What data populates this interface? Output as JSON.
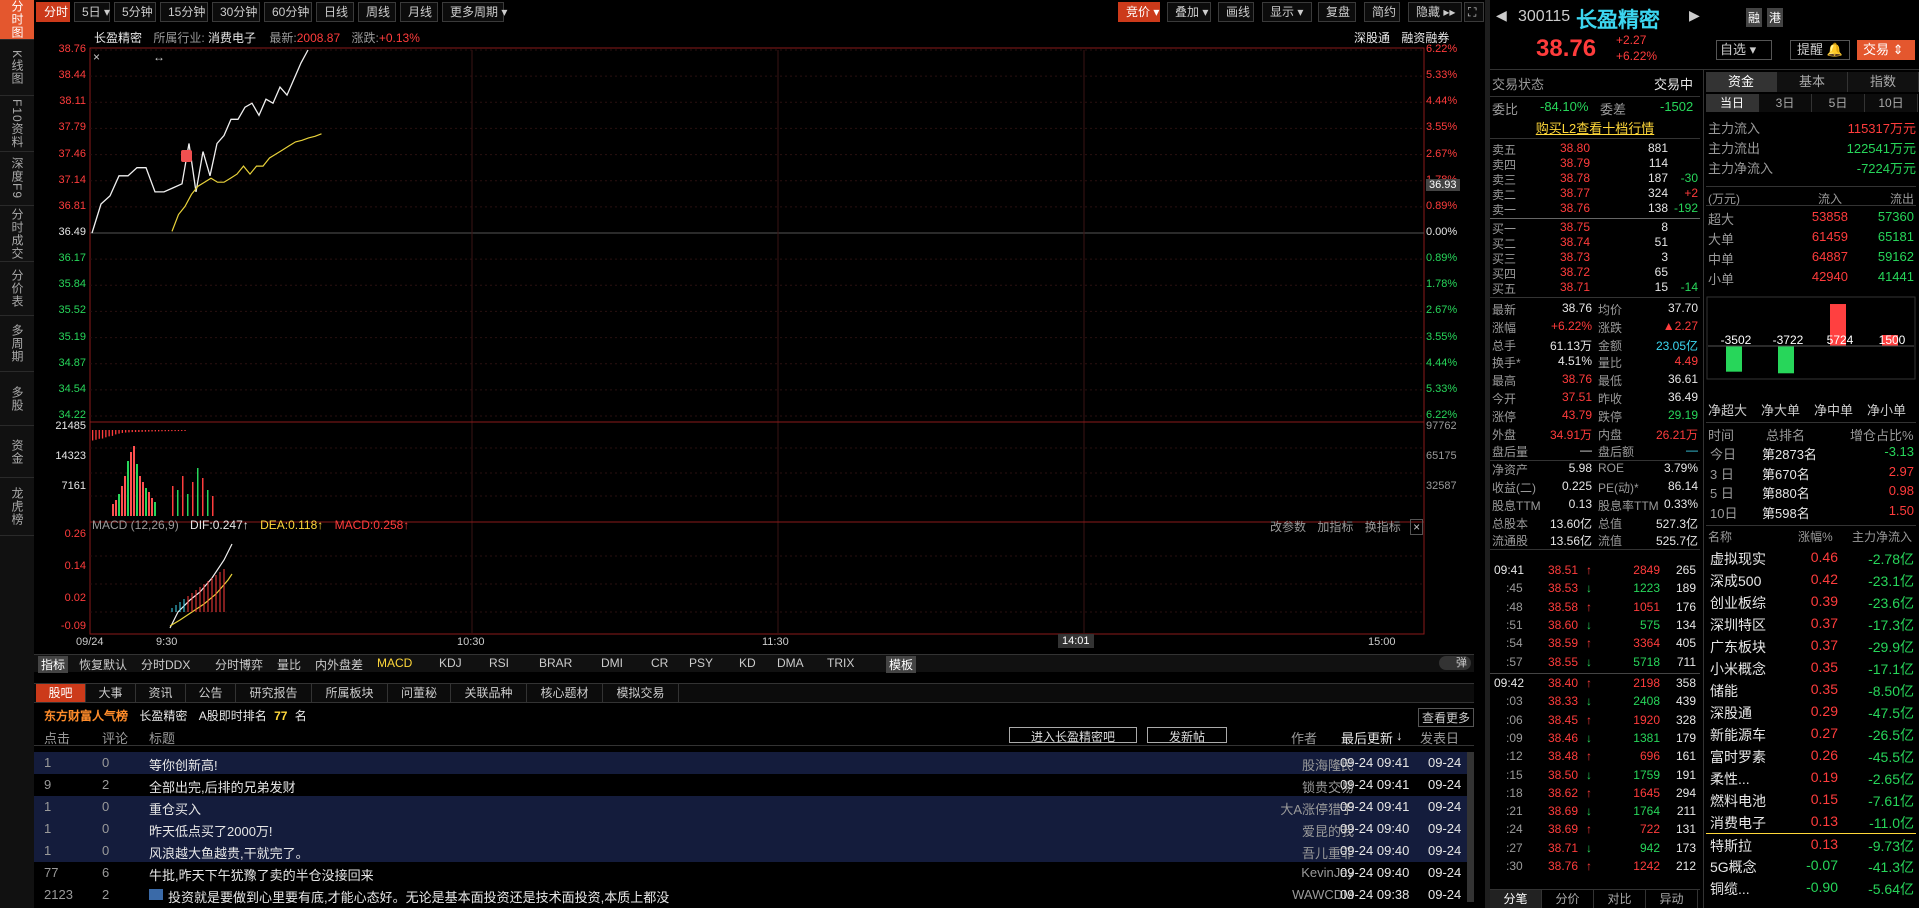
{
  "side_tabs": [
    "分时图",
    "K线图",
    "F10资料",
    "深度F9",
    "分时成交",
    "分价表",
    "多周期",
    "多股",
    "资金",
    "龙虎榜"
  ],
  "toolbar": {
    "periods": [
      "分时",
      "5日",
      "5分钟",
      "15分钟",
      "30分钟",
      "60分钟",
      "日线",
      "周线",
      "月线",
      "更多周期"
    ],
    "right": [
      "竞价",
      "叠加",
      "画线",
      "显示",
      "复盘",
      "简约",
      "隐藏"
    ]
  },
  "chart_header": {
    "name": "长盈精密",
    "industry_label": "所属行业:",
    "industry": "消费电子",
    "latest_label": "最新:",
    "latest": "2008.87",
    "change_label": "涨跌:",
    "change": "+0.13%",
    "links": [
      "深股通",
      "融资融券"
    ]
  },
  "chart_data": [
    {
      "type": "line",
      "x_ticks": [
        "09/24",
        "9:30",
        "10:30",
        "11:30",
        "14:01",
        "15:00"
      ],
      "y_ticks": [
        "38.76",
        "38.44",
        "38.11",
        "37.79",
        "37.46",
        "37.14",
        "36.81",
        "36.49",
        "36.17",
        "35.84",
        "35.52",
        "35.19",
        "34.87",
        "34.54",
        "34.22"
      ],
      "y_ticks_pct": [
        "6.22%",
        "5.33%",
        "4.44%",
        "3.55%",
        "2.67%",
        "1.78%",
        "0.89%",
        "0.00%",
        "0.89%",
        "1.78%",
        "2.67%",
        "3.55%",
        "4.44%",
        "5.33%",
        "6.22%"
      ],
      "ylim": [
        34.22,
        38.76
      ],
      "base": 36.49,
      "crosshair_price": "36.93",
      "crosshair_time": "14:01",
      "series": [
        {
          "values": [
            36.49,
            36.85,
            36.95,
            37.2,
            37.2,
            37.3,
            37.3,
            37.0,
            37.0,
            37.05,
            37.1,
            37.6,
            37.0,
            37.5,
            37.2,
            37.6,
            37.7,
            37.9,
            37.9,
            38.05,
            38.1,
            37.95,
            38.15,
            38.1,
            38.3,
            38.2,
            38.4,
            38.6,
            38.76
          ]
        },
        {
          "values": [
            36.49,
            36.7,
            36.8,
            36.95,
            37.05,
            37.1,
            37.15,
            37.1,
            37.1,
            37.15,
            37.2,
            37.3,
            37.2,
            37.3,
            37.3,
            37.4,
            37.45,
            37.5,
            37.55,
            37.6,
            37.62,
            37.65,
            37.67,
            37.7
          ]
        }
      ]
    },
    {
      "type": "bar",
      "y_ticks": [
        "21485",
        "14323",
        "7161"
      ],
      "y_ticks_right": [
        "97762",
        "65175",
        "32587"
      ],
      "values": [
        21485,
        20000,
        18000,
        17500,
        15000,
        13000,
        12000,
        9000,
        7500,
        6000,
        5200,
        4800,
        4300,
        4200,
        4000,
        3800,
        3500,
        3200,
        3000,
        2900,
        2800,
        2600,
        2500,
        2400,
        2300,
        2250,
        2200,
        2100,
        2000
      ]
    },
    {
      "type": "line",
      "title": "MACD (12,26,9)",
      "dif": "DIF:0.247",
      "dea": "DEA:0.118",
      "macd": "MACD:0.258",
      "links": [
        "改参数",
        "加指标",
        "换指标"
      ],
      "y_ticks": [
        "0.26",
        "0.14",
        "0.02",
        "-0.09"
      ]
    }
  ],
  "indicator_tabs": [
    "指标",
    "恢复默认",
    "分时DDX",
    "分时博弈",
    "量比",
    "内外盘差",
    "MACD",
    "KDJ",
    "RSI",
    "BRAR",
    "DMI",
    "CR",
    "PSY",
    "KD",
    "DMA",
    "TRIX",
    "模板"
  ],
  "bottom_tabs": [
    "股吧",
    "大事",
    "资讯",
    "公告",
    "研究报告",
    "所属板块",
    "问董秘",
    "关联品种",
    "核心题材",
    "模拟交易"
  ],
  "bottom_sub": {
    "rank_label": "东方财富人气榜",
    "stock": "长盈精密",
    "rank_text": "A股即时排名",
    "rank": "77",
    "unit": "名",
    "more": "查看更多"
  },
  "post_head": {
    "clicks": "点击",
    "comments": "评论",
    "title": "标题",
    "enter": "进入长盈精密吧",
    "post": "发新帖",
    "author": "作者",
    "latest": "最后更新",
    "date": "发表日"
  },
  "posts": [
    {
      "c": "1",
      "r": "0",
      "t": "等你创新高!",
      "a": "股海隆民",
      "u": "09-24 09:41",
      "d": "09-24"
    },
    {
      "c": "9",
      "r": "2",
      "t": "全部出完,后排的兄弟发财",
      "a": "锁贵交易",
      "u": "09-24 09:41",
      "d": "09-24"
    },
    {
      "c": "1",
      "r": "0",
      "t": "重仓买入",
      "a": "大A涨停猎手",
      "u": "09-24 09:41",
      "d": "09-24"
    },
    {
      "c": "1",
      "r": "0",
      "t": "昨天低点买了2000万!",
      "a": "爱昆的我",
      "u": "09-24 09:40",
      "d": "09-24"
    },
    {
      "c": "1",
      "r": "0",
      "t": "风浪越大鱼越贵,干就完了。",
      "a": "吾儿重菲",
      "u": "09-24 09:40",
      "d": "09-24"
    },
    {
      "c": "77",
      "r": "6",
      "t": "牛批,昨天下午犹豫了卖的半仓没接回来",
      "a": "KevinJay",
      "u": "09-24 09:40",
      "d": "09-24"
    },
    {
      "c": "2123",
      "r": "2",
      "t": "投资就是要做到心里要有底,才能心态好。无论是基本面投资还是技术面投资,本质上都没",
      "a": "WAWCDM",
      "u": "09-24 09:38",
      "d": "09-24"
    }
  ],
  "quote": {
    "code": "300115",
    "name": "长盈精密",
    "price": "38.76",
    "chg": "+2.27",
    "pct": "+6.22%",
    "btns": [
      "融",
      "港"
    ],
    "actions": [
      "自选",
      "提醒",
      "交易"
    ]
  },
  "status": {
    "label": "交易状态",
    "value": "交易中",
    "wb_label": "委比",
    "wb": "-84.10%",
    "wc_label": "委差",
    "wc": "-1502",
    "l2": "购买L2查看十档行情"
  },
  "sells": [
    {
      "l": "卖五",
      "p": "38.80",
      "v": "881",
      "d": ""
    },
    {
      "l": "卖四",
      "p": "38.79",
      "v": "114",
      "d": ""
    },
    {
      "l": "卖三",
      "p": "38.78",
      "v": "187",
      "d": "-30"
    },
    {
      "l": "卖二",
      "p": "38.77",
      "v": "324",
      "d": "+2"
    },
    {
      "l": "卖一",
      "p": "38.76",
      "v": "138",
      "d": "-192"
    }
  ],
  "buys": [
    {
      "l": "买一",
      "p": "38.75",
      "v": "8",
      "d": ""
    },
    {
      "l": "买二",
      "p": "38.74",
      "v": "51",
      "d": ""
    },
    {
      "l": "买三",
      "p": "38.73",
      "v": "3",
      "d": ""
    },
    {
      "l": "买四",
      "p": "38.72",
      "v": "65",
      "d": ""
    },
    {
      "l": "买五",
      "p": "38.71",
      "v": "15",
      "d": "-14"
    }
  ],
  "stats": [
    [
      "最新",
      "38.76",
      "均价",
      "37.70"
    ],
    [
      "涨幅",
      "+6.22%",
      "涨跌",
      "▲2.27"
    ],
    [
      "总手",
      "61.13万",
      "金额",
      "23.05亿"
    ],
    [
      "换手*",
      "4.51%",
      "量比",
      "4.49"
    ],
    [
      "最高",
      "38.76",
      "最低",
      "36.61"
    ],
    [
      "今开",
      "37.51",
      "昨收",
      "36.49"
    ],
    [
      "涨停",
      "43.79",
      "跌停",
      "29.19"
    ],
    [
      "外盘",
      "34.91万",
      "内盘",
      "26.21万"
    ],
    [
      "盘后量",
      "—",
      "盘后额",
      "—"
    ],
    [
      "净资产",
      "5.98",
      "ROE",
      "3.79%"
    ],
    [
      "收益(二)",
      "0.225",
      "PE(动)*",
      "86.14"
    ],
    [
      "股息TTM",
      "0.13",
      "股息率TTM",
      "0.33%"
    ],
    [
      "总股本",
      "13.60亿",
      "总值",
      "527.3亿"
    ],
    [
      "流通股",
      "13.56亿",
      "流值",
      "525.7亿"
    ]
  ],
  "ticks1": [
    {
      "t": "09:41",
      "p": "38.51",
      "v": "2849",
      "n": "265"
    },
    {
      "t": ":45",
      "p": "38.53",
      "v": "1223",
      "n": "189"
    },
    {
      "t": ":48",
      "p": "38.58",
      "v": "1051",
      "n": "176"
    },
    {
      "t": ":51",
      "p": "38.60",
      "v": "575",
      "n": "134"
    },
    {
      "t": ":54",
      "p": "38.59",
      "v": "3364",
      "n": "405"
    },
    {
      "t": ":57",
      "p": "38.55",
      "v": "5718",
      "n": "711"
    }
  ],
  "ticks2": [
    {
      "t": "09:42",
      "p": "38.40",
      "v": "2198",
      "n": "358"
    },
    {
      "t": ":03",
      "p": "38.33",
      "v": "2408",
      "n": "439"
    },
    {
      "t": ":06",
      "p": "38.45",
      "v": "1920",
      "n": "328"
    },
    {
      "t": ":09",
      "p": "38.46",
      "v": "1381",
      "n": "179"
    },
    {
      "t": ":12",
      "p": "38.48",
      "v": "696",
      "n": "161"
    },
    {
      "t": ":15",
      "p": "38.50",
      "v": "1759",
      "n": "191"
    },
    {
      "t": ":18",
      "p": "38.62",
      "v": "1645",
      "n": "294"
    },
    {
      "t": ":21",
      "p": "38.69",
      "v": "1764",
      "n": "211"
    },
    {
      "t": ":24",
      "p": "38.69",
      "v": "722",
      "n": "131"
    },
    {
      "t": ":27",
      "p": "38.71",
      "v": "942",
      "n": "173"
    },
    {
      "t": ":30",
      "p": "38.76",
      "v": "1242",
      "n": "212"
    }
  ],
  "tick_tabs": [
    "分笔",
    "分价",
    "对比",
    "异动"
  ],
  "fund_tabs": [
    "资金",
    "基本",
    "指数"
  ],
  "fund_period": [
    "当日",
    "3日",
    "5日",
    "10日"
  ],
  "fund_flow": [
    {
      "l": "主力流入",
      "v": "115317万元"
    },
    {
      "l": "主力流出",
      "v": "122541万元"
    },
    {
      "l": "主力净流入",
      "v": "-7224万元"
    }
  ],
  "fund_table_head": [
    "(万元)",
    "流入",
    "流出"
  ],
  "fund_table": [
    {
      "l": "超大",
      "i": "53858",
      "o": "57360"
    },
    {
      "l": "大单",
      "i": "61459",
      "o": "65181"
    },
    {
      "l": "中单",
      "i": "64887",
      "o": "59162"
    },
    {
      "l": "小单",
      "i": "42940",
      "o": "41441"
    }
  ],
  "net_bars": {
    "values": [
      -3502,
      -3722,
      5724,
      1500
    ],
    "labels": [
      "-3502",
      "-3722",
      "5724",
      "1500"
    ],
    "cats": [
      "净超大",
      "净大单",
      "净中单",
      "净小单"
    ]
  },
  "rank_head": [
    "时间",
    "总排名",
    "增仓占比%"
  ],
  "ranks": [
    {
      "t": "今日",
      "r": "第2873名",
      "p": "-3.13"
    },
    {
      "t": "3 日",
      "r": "第670名",
      "p": "2.97"
    },
    {
      "t": "5 日",
      "r": "第880名",
      "p": "0.98"
    },
    {
      "t": "10日",
      "r": "第598名",
      "p": "1.50"
    }
  ],
  "sector_head": [
    "名称",
    "涨幅%",
    "主力净流入"
  ],
  "sectors": [
    {
      "n": "虚拟现实",
      "p": "0.46",
      "f": "-2.78亿"
    },
    {
      "n": "深成500",
      "p": "0.42",
      "f": "-23.1亿"
    },
    {
      "n": "创业板综",
      "p": "0.39",
      "f": "-23.6亿"
    },
    {
      "n": "深圳特区",
      "p": "0.37",
      "f": "-17.3亿"
    },
    {
      "n": "广东板块",
      "p": "0.37",
      "f": "-29.9亿"
    },
    {
      "n": "小米概念",
      "p": "0.35",
      "f": "-17.1亿"
    },
    {
      "n": "储能",
      "p": "0.35",
      "f": "-8.50亿"
    },
    {
      "n": "深股通",
      "p": "0.29",
      "f": "-47.5亿"
    },
    {
      "n": "新能源车",
      "p": "0.27",
      "f": "-26.5亿"
    },
    {
      "n": "富时罗素",
      "p": "0.26",
      "f": "-45.5亿"
    },
    {
      "n": "柔性...",
      "p": "0.19",
      "f": "-2.65亿"
    },
    {
      "n": "燃料电池",
      "p": "0.15",
      "f": "-7.61亿"
    },
    {
      "n": "消费电子",
      "p": "0.13",
      "f": "-11.0亿"
    },
    {
      "n": "特斯拉",
      "p": "0.13",
      "f": "-9.73亿"
    },
    {
      "n": "5G概念",
      "p": "-0.07",
      "f": "-41.3亿"
    },
    {
      "n": "铜缆...",
      "p": "-0.90",
      "f": "-5.64亿"
    }
  ]
}
